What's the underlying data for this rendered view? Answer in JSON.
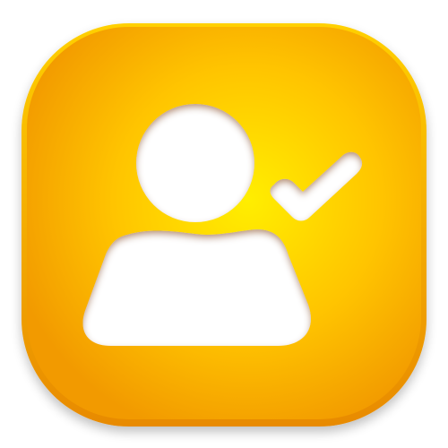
{
  "icon": {
    "name": "user-verified-icon",
    "glyphs": [
      "user-silhouette-icon",
      "checkmark-icon"
    ]
  },
  "colors": {
    "tile_center": "#ffee00",
    "tile_mid": "#ffc400",
    "tile_edge": "#f29a00",
    "tile_rim": "#e88a00",
    "glyph": "#ffffff",
    "glyph_shadow": "#a86a00"
  }
}
